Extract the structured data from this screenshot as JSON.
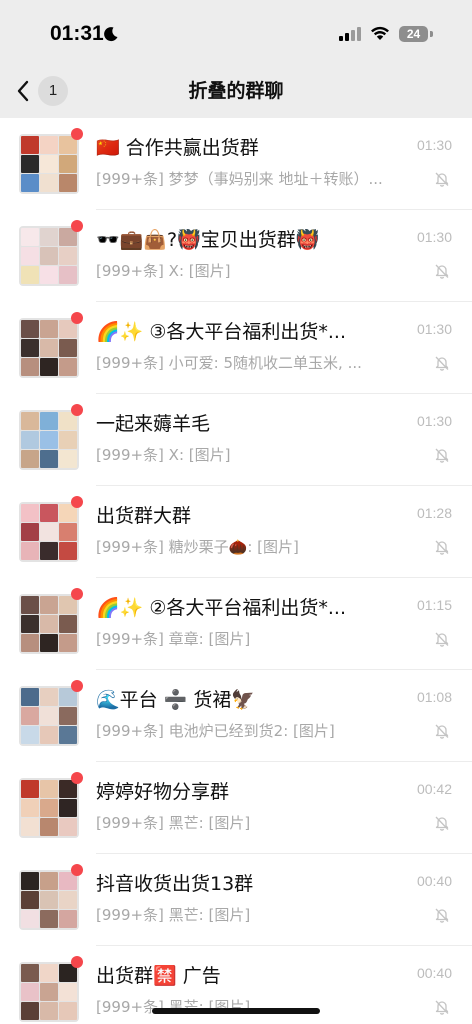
{
  "status_bar": {
    "time": "01:31",
    "battery": "24"
  },
  "header": {
    "back_count": "1",
    "title": "折叠的群聊"
  },
  "chats": [
    {
      "title": "🇨🇳 合作共赢出货群",
      "subtitle": "[999+条] 梦梦（事妈别来 地址＋转账）...",
      "time": "01:30",
      "avatar_colors": [
        "#c0392b",
        "#f4d3c4",
        "#e8c39e",
        "#2a2a2a",
        "#f6e7d8",
        "#d1a87a",
        "#5a8dc8",
        "#f0e0d0",
        "#b9876a"
      ]
    },
    {
      "title": "🕶️💼👜?👹宝贝出货群👹",
      "subtitle": "[999+条] X: [图片]",
      "time": "01:30",
      "avatar_colors": [
        "#f7e8ea",
        "#e0d3cf",
        "#caa9a0",
        "#f5dfe4",
        "#d8c2b8",
        "#e7cfc5",
        "#f0e2b6",
        "#f7e0e6",
        "#e6c0c6"
      ]
    },
    {
      "title": "🌈✨ ③各大平台福利出货*...",
      "subtitle": "[999+条] 小可爱: 5随机收二单玉米, ...",
      "time": "01:30",
      "avatar_colors": [
        "#6b4f48",
        "#c9a492",
        "#e6c9bd",
        "#3b2f2c",
        "#d8b9a8",
        "#7a5b4f",
        "#b78f7e",
        "#2e2522",
        "#c49b8a"
      ]
    },
    {
      "title": "一起来薅羊毛",
      "subtitle": "[999+条] X: [图片]",
      "time": "01:30",
      "avatar_colors": [
        "#d9b89a",
        "#7fb0d8",
        "#f0e1c7",
        "#b0c9e0",
        "#9ac0e6",
        "#e8d0b6",
        "#c7a589",
        "#4e6e8e",
        "#f3e6d1"
      ]
    },
    {
      "title": "出货群大群",
      "subtitle": "[999+条] 糖炒栗子🌰: [图片]",
      "time": "01:28",
      "avatar_colors": [
        "#f3c1c6",
        "#c9565e",
        "#f5d6b8",
        "#a33f46",
        "#f2e3e0",
        "#d87f6f",
        "#e8b4b8",
        "#3a2c2c",
        "#c44a42"
      ]
    },
    {
      "title": "🌈✨ ②各大平台福利出货*...",
      "subtitle": "[999+条] 章章: [图片]",
      "time": "01:15",
      "avatar_colors": [
        "#6b4f48",
        "#c9a492",
        "#e0c6b0",
        "#3b2f2c",
        "#d8b9a8",
        "#7a5b4f",
        "#b78f7e",
        "#2e2522",
        "#c49b8a"
      ]
    },
    {
      "title": "🌊平台 ➗ 货裙🦅",
      "subtitle": "[999+条] 电池炉已经到货2: [图片]",
      "time": "01:08",
      "avatar_colors": [
        "#4c6b8c",
        "#e7cfc0",
        "#b7c9d9",
        "#d9a8a0",
        "#f0e0d8",
        "#8a6a5e",
        "#c8d9e8",
        "#e6c8b8",
        "#5a7896"
      ]
    },
    {
      "title": "婷婷好物分享群",
      "subtitle": "[999+条] 黑芒: [图片]",
      "time": "00:42",
      "avatar_colors": [
        "#c0392b",
        "#e7c5a8",
        "#3b2a26",
        "#f0d0b8",
        "#d9a98c",
        "#2f2523",
        "#f2e0d2",
        "#b8876e",
        "#e9c9c0"
      ]
    },
    {
      "title": "抖音收货出货13群",
      "subtitle": "[999+条] 黑芒: [图片]",
      "time": "00:40",
      "avatar_colors": [
        "#2b2421",
        "#c7a08a",
        "#e8b9c2",
        "#5a3f36",
        "#d9c3b4",
        "#e9d4c6",
        "#f1dfe2",
        "#8c6b5e",
        "#d4a6a0"
      ]
    },
    {
      "title": "出货群🈲 广告",
      "subtitle": "[999+条] 黑芒: [图片]",
      "time": "00:40",
      "avatar_colors": [
        "#7a5b4f",
        "#f0d6c8",
        "#2b2421",
        "#e9c2c8",
        "#c9a492",
        "#f3e1d6",
        "#5a3f36",
        "#d8b9a8",
        "#e6c8b8"
      ]
    }
  ]
}
